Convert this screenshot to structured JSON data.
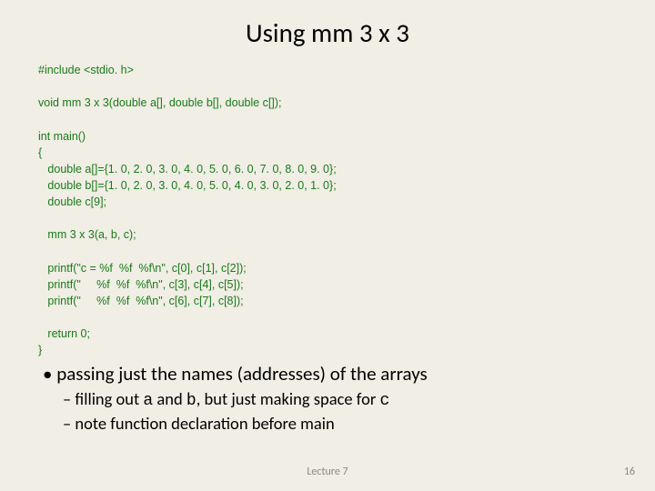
{
  "title": "Using mm 3 x 3",
  "code": "#include <stdio. h>\n\nvoid mm 3 x 3(double a[], double b[], double c[]);\n\nint main()\n{\n   double a[]={1. 0, 2. 0, 3. 0, 4. 0, 5. 0, 6. 0, 7. 0, 8. 0, 9. 0};\n   double b[]={1. 0, 2. 0, 3. 0, 4. 0, 5. 0, 4. 0, 3. 0, 2. 0, 1. 0};\n   double c[9];\n\n   mm 3 x 3(a, b, c);\n\n   printf(\"c = %f  %f  %f\\n\", c[0], c[1], c[2]);\n   printf(\"     %f  %f  %f\\n\", c[3], c[4], c[5]);\n   printf(\"     %f  %f  %f\\n\", c[6], c[7], c[8]);\n\n   return 0;\n}",
  "notes": {
    "bullet1": "passing just the names (addresses) of the arrays",
    "bullet2a_pre": "filling out ",
    "bullet2a_a": "a",
    "bullet2a_mid": " and ",
    "bullet2a_b": "b",
    "bullet2a_mid2": ", but just making space for ",
    "bullet2a_c": "c",
    "bullet2b": "note function declaration before main"
  },
  "footer": {
    "center": "Lecture 7",
    "right": "16"
  }
}
